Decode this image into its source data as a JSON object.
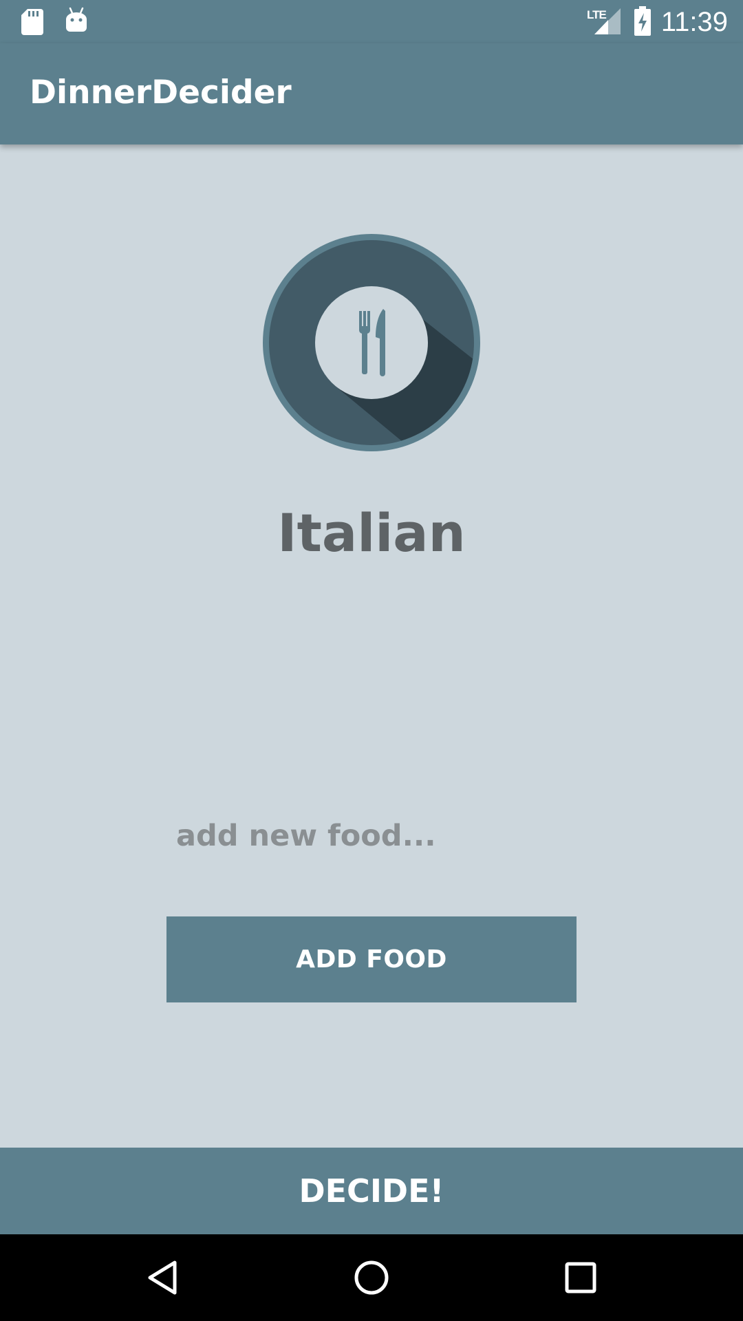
{
  "status_bar": {
    "time": "11:39",
    "network_label": "LTE",
    "icons": [
      "sd-card-icon",
      "android-icon",
      "lte-signal-icon",
      "battery-charging-icon"
    ]
  },
  "app_bar": {
    "title": "DinnerDecider"
  },
  "main": {
    "icon": "plate-fork-knife-icon",
    "selected_food": "Italian",
    "food_input": {
      "value": "",
      "placeholder": "add new food..."
    },
    "add_button_label": "ADD FOOD"
  },
  "decide_button_label": "DECIDE!",
  "nav_bar": {
    "icons": [
      "back-icon",
      "home-icon",
      "recents-icon"
    ]
  },
  "colors": {
    "primary": "#5c808e",
    "background": "#cdd7dd",
    "plate_dark": "#425b67",
    "text": "#5e6366"
  }
}
